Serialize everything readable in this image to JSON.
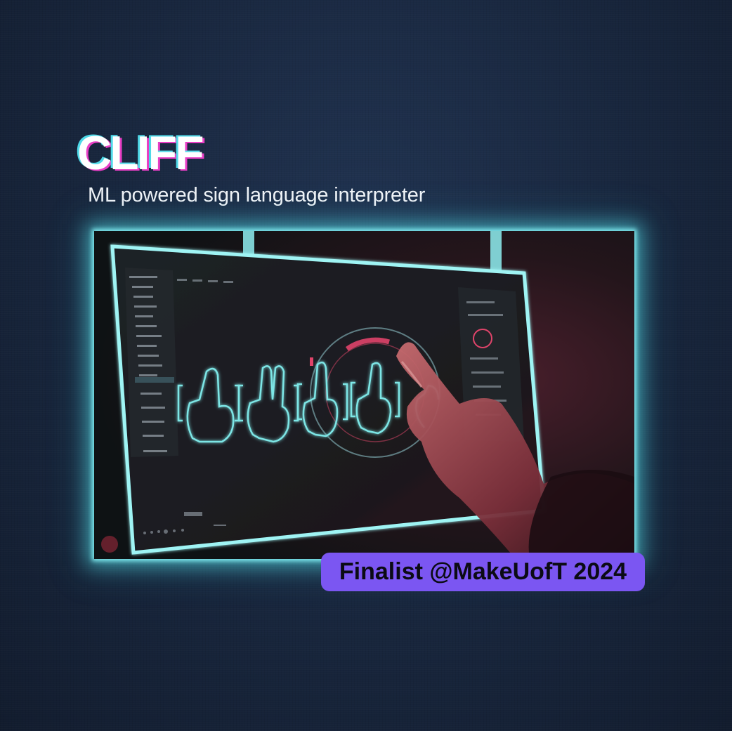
{
  "title": "CLIFF",
  "subtitle": "ML powered sign language interpreter",
  "badge": "Finalist @MakeUofT 2024",
  "colors": {
    "background": "#18263d",
    "glow": "#7fe9ee",
    "title_shadow_cyan": "#4fd9e8",
    "title_shadow_magenta": "#e93fc6",
    "badge_bg": "#7b56f2",
    "accent_red": "#e0446a"
  },
  "hero": {
    "description_icon": "monitor-with-hand-gestures-image"
  }
}
